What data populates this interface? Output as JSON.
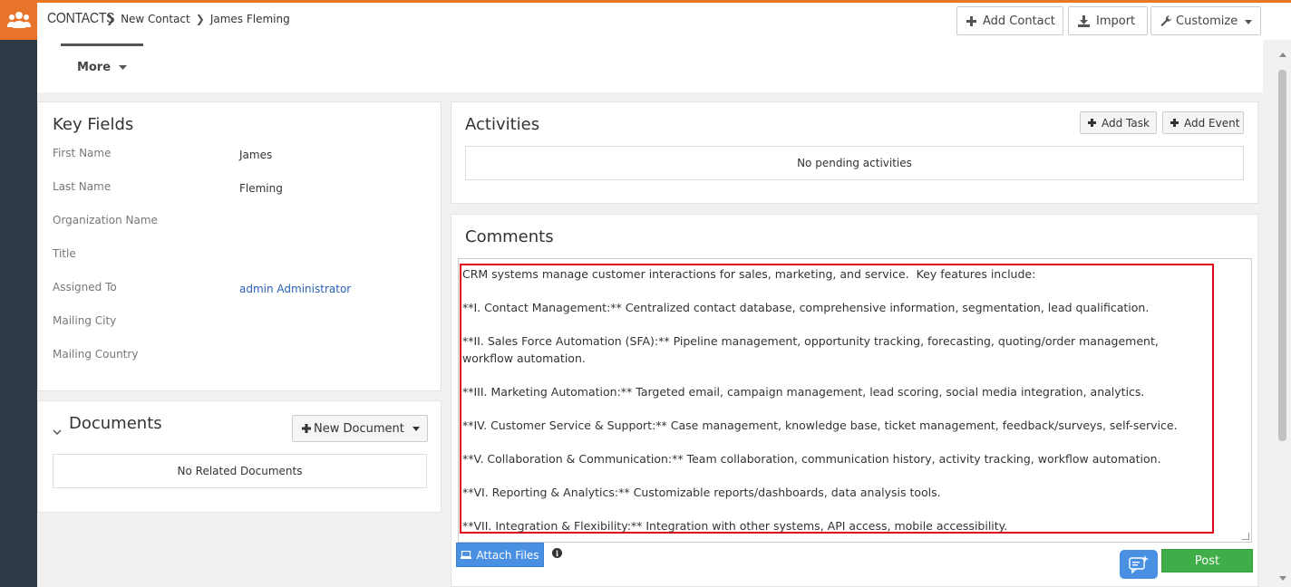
{
  "breadcrumb": {
    "module": "CONTACTS",
    "items": [
      "New Contact",
      "James Fleming"
    ]
  },
  "header_buttons": {
    "add_contact": "Add Contact",
    "import": "Import",
    "customize": "Customize"
  },
  "tabs": {
    "more": "More"
  },
  "key_fields": {
    "title": "Key Fields",
    "rows": [
      {
        "label": "First Name",
        "value": "James"
      },
      {
        "label": "Last Name",
        "value": "Fleming"
      },
      {
        "label": "Organization Name",
        "value": ""
      },
      {
        "label": "Title",
        "value": ""
      },
      {
        "label": "Assigned To",
        "value": "admin Administrator"
      },
      {
        "label": "Mailing City",
        "value": ""
      },
      {
        "label": "Mailing Country",
        "value": ""
      }
    ]
  },
  "documents": {
    "title": "Documents",
    "new_button": "New Document",
    "empty": "No Related Documents"
  },
  "activities": {
    "title": "Activities",
    "add_task": "Add Task",
    "add_event": "Add Event",
    "empty": "No pending activities"
  },
  "comments": {
    "title": "Comments",
    "text": "CRM systems manage customer interactions for sales, marketing, and service.  Key features include:\n\n**I. Contact Management:** Centralized contact database, comprehensive information, segmentation, lead qualification.\n\n**II. Sales Force Automation (SFA):** Pipeline management, opportunity tracking, forecasting, quoting/order management, workflow automation.\n\n**III. Marketing Automation:** Targeted email, campaign management, lead scoring, social media integration, analytics.\n\n**IV. Customer Service & Support:** Case management, knowledge base, ticket management, feedback/surveys, self-service.\n\n**V. Collaboration & Communication:** Team collaboration, communication history, activity tracking, workflow automation.\n\n**VI. Reporting & Analytics:** Customizable reports/dashboards, data analysis tools.\n\n**VII. Integration & Flexibility:** Integration with other systems, API access, mobile accessibility.",
    "attach_files": "Attach Files",
    "post": "Post"
  },
  "colors": {
    "accent": "#e8742a",
    "sidebar": "#2e3a46",
    "link": "#2a62b8",
    "post": "#3fae48",
    "attach": "#4a90e2",
    "highlight": "#e0001a"
  }
}
